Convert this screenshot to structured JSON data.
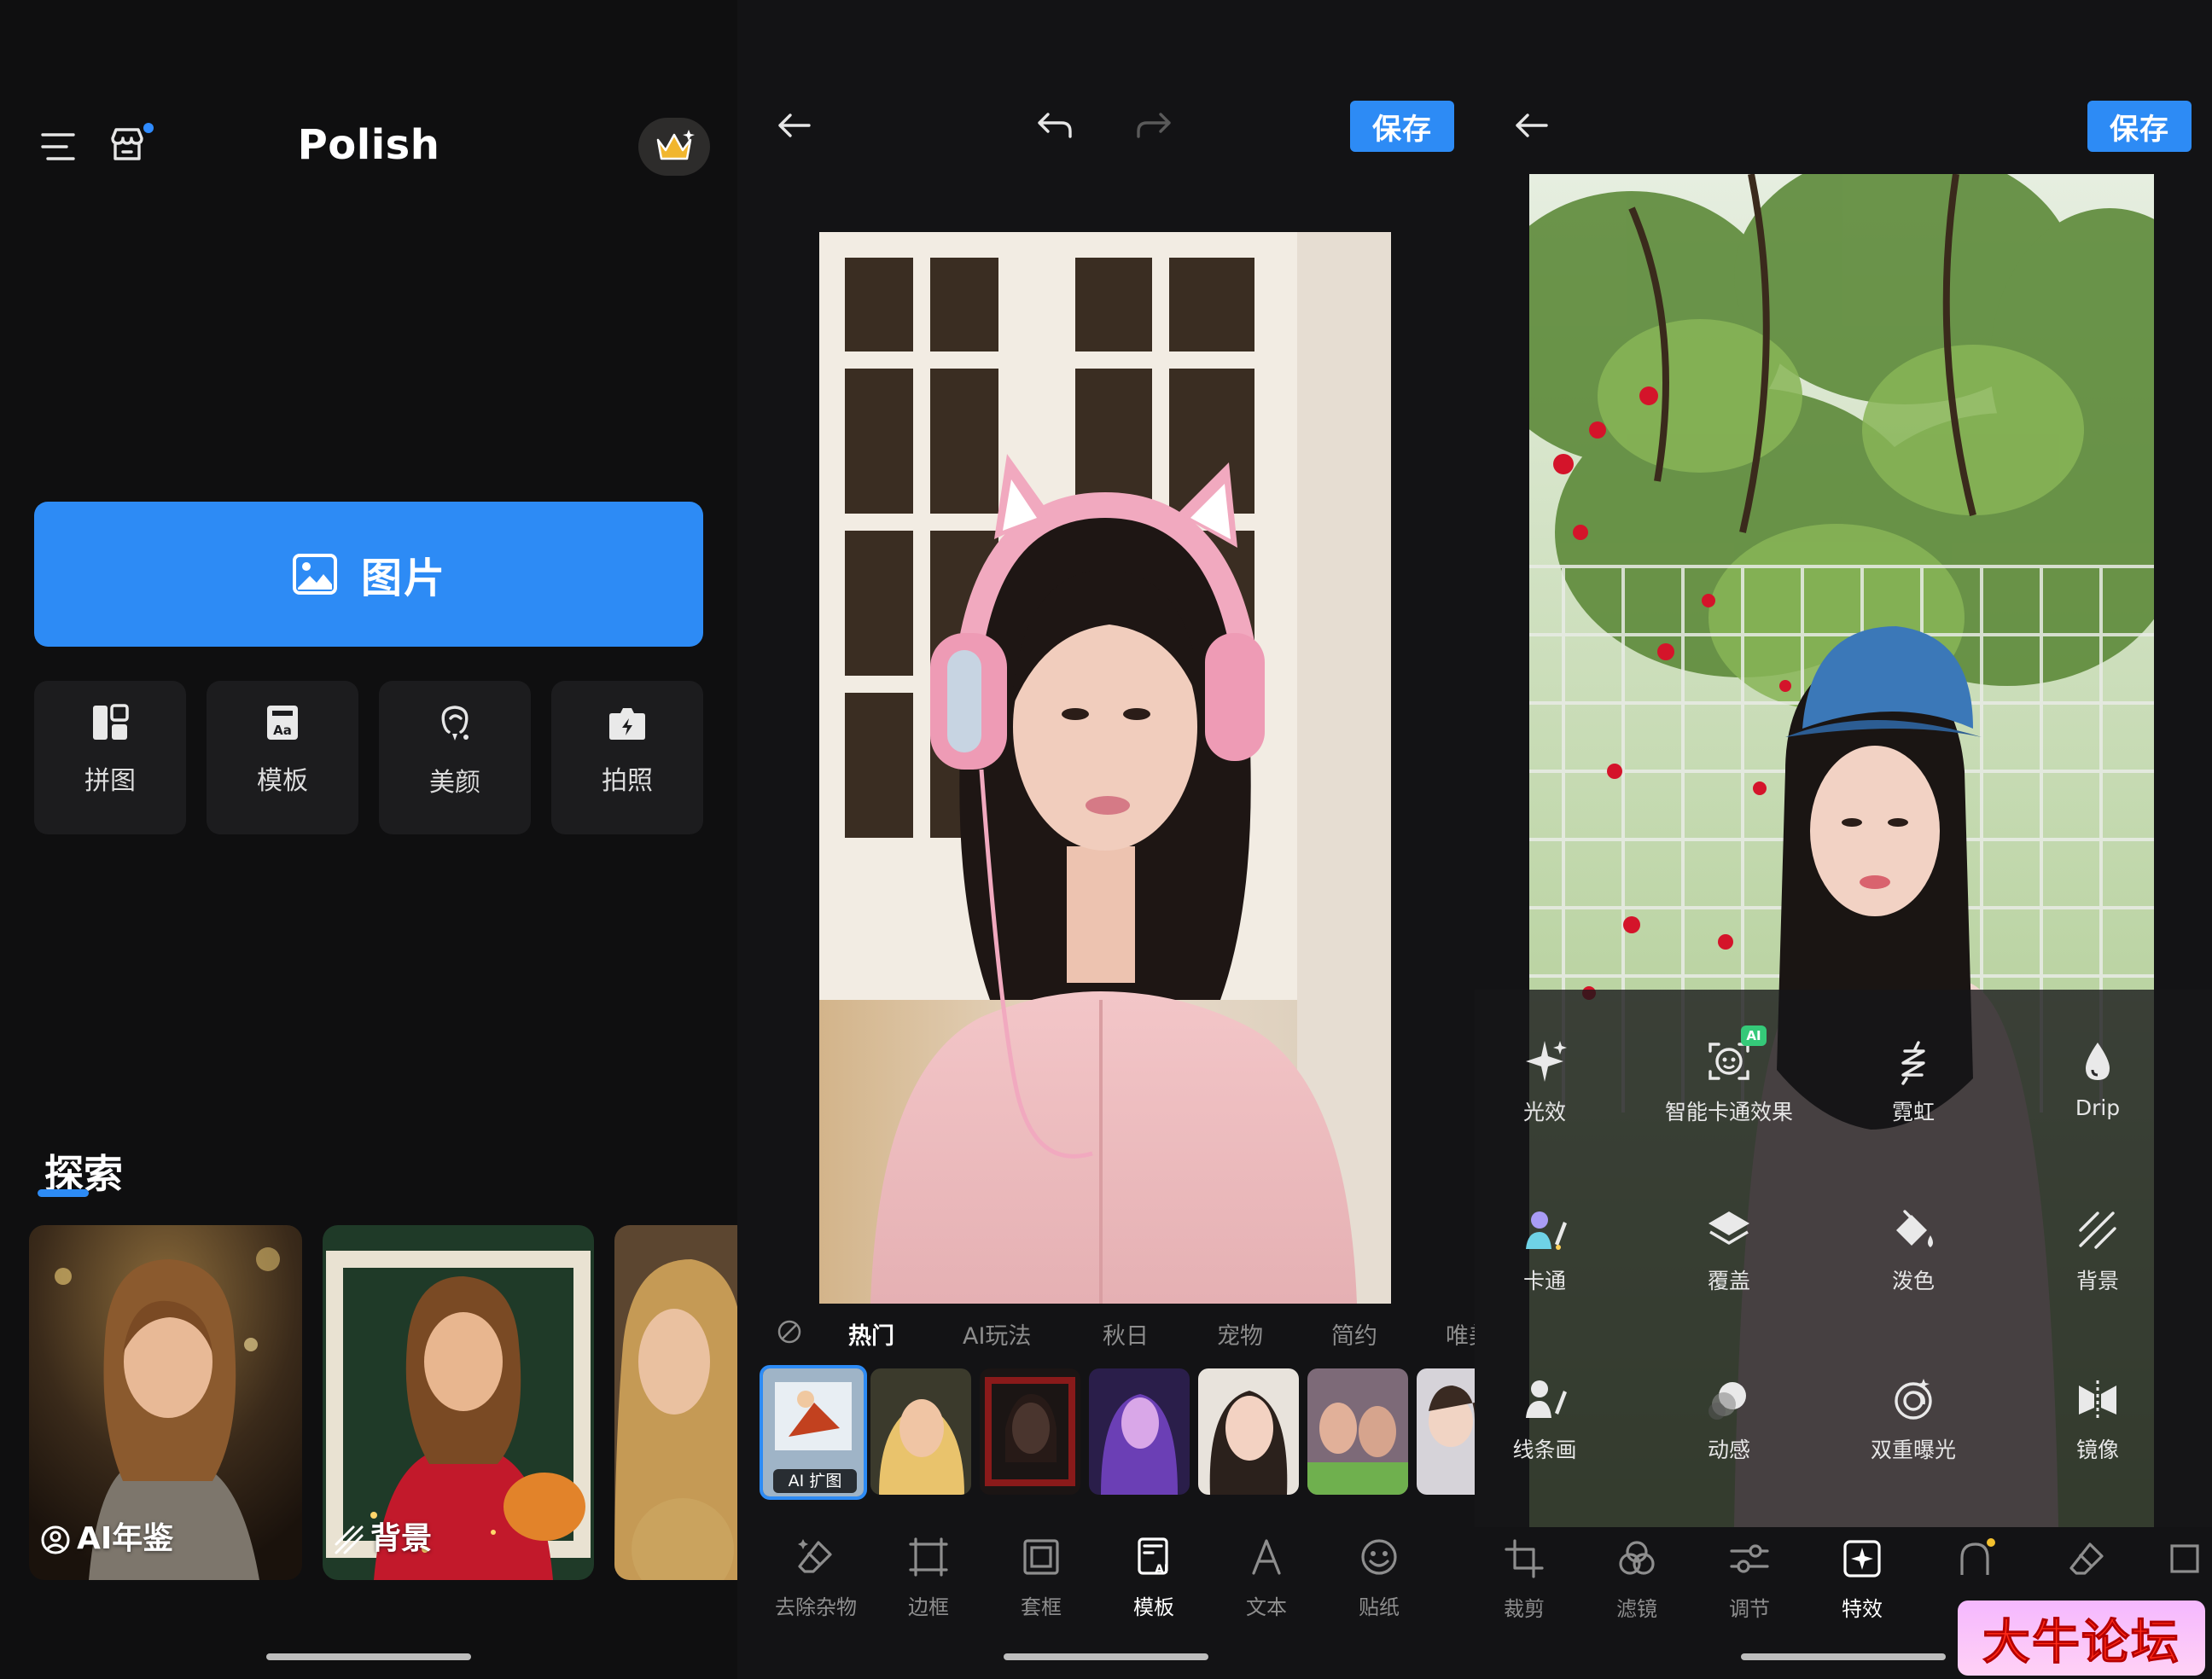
{
  "home": {
    "app_title": "Polish",
    "picture_button": "图片",
    "tools": [
      "拼图",
      "模板",
      "美颜",
      "拍照"
    ],
    "explore_title": "探索",
    "cards": [
      "AI年鉴",
      "背景"
    ]
  },
  "template_editor": {
    "save_label": "保存",
    "categories": [
      "热门",
      "AI玩法",
      "秋日",
      "宠物",
      "简约",
      "唯美"
    ],
    "active_category": "热门",
    "selected_thumb_tag": "AI 扩图",
    "bottom_tools": [
      "去除杂物",
      "边框",
      "套框",
      "模板",
      "文本",
      "贴纸"
    ],
    "active_tool": "模板"
  },
  "effects_editor": {
    "save_label": "保存",
    "effects": [
      "光效",
      "智能卡通效果",
      "霓虹",
      "Drip",
      "卡通",
      "覆盖",
      "泼色",
      "背景",
      "线条画",
      "动感",
      "双重曝光",
      "镜像"
    ],
    "ai_badge": "AI",
    "bottom_tools": [
      "裁剪",
      "滤镜",
      "调节",
      "特效"
    ],
    "active_tool": "特效",
    "watermark": "大牛论坛"
  },
  "colors": {
    "accent": "#2d8bf5",
    "background": "#101012",
    "ai_green": "#35c979"
  }
}
